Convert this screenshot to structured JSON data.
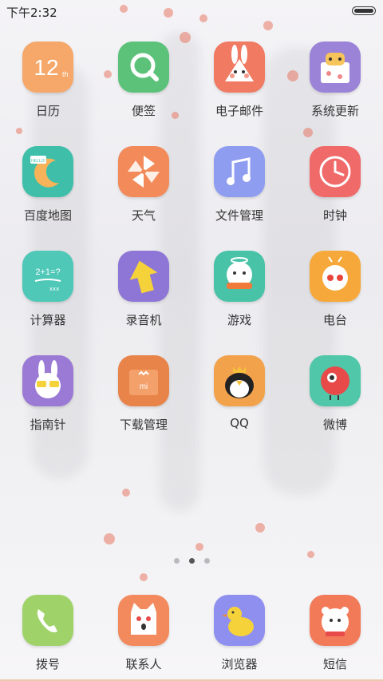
{
  "status_bar": {
    "time": "下午2:32",
    "battery_icon": "battery-icon"
  },
  "apps": [
    {
      "label": "日历",
      "icon": "calendar-icon",
      "color": "#f5a86a",
      "glyph": "12",
      "sub": "th"
    },
    {
      "label": "便签",
      "icon": "notes-icon",
      "color": "#5cc27a"
    },
    {
      "label": "电子邮件",
      "icon": "rabbit-mail-icon",
      "color": "#f07a62"
    },
    {
      "label": "系统更新",
      "icon": "box-update-icon",
      "color": "#9b84d8"
    },
    {
      "label": "百度地图",
      "icon": "moon-map-icon",
      "color": "#3fbfa9",
      "glyph": "HELLO!"
    },
    {
      "label": "天气",
      "icon": "pinwheel-icon",
      "color": "#f28a5a"
    },
    {
      "label": "文件管理",
      "icon": "music-note-icon",
      "color": "#8f9df0"
    },
    {
      "label": "时钟",
      "icon": "clock-icon",
      "color": "#f06a6a"
    },
    {
      "label": "计算器",
      "icon": "chalkboard-icon",
      "color": "#4fc8b8",
      "glyph": "2+1=?"
    },
    {
      "label": "录音机",
      "icon": "arrow-up-icon",
      "color": "#8d76d6"
    },
    {
      "label": "游戏",
      "icon": "bear-scarf-icon",
      "color": "#49c3a8"
    },
    {
      "label": "电台",
      "icon": "radio-bear-icon",
      "color": "#f6a93a"
    },
    {
      "label": "指南针",
      "icon": "bunny-glasses-icon",
      "color": "#9a7ad4"
    },
    {
      "label": "下载管理",
      "icon": "download-box-icon",
      "color": "#e8844a",
      "glyph": "mi"
    },
    {
      "label": "QQ",
      "icon": "penguin-icon",
      "color": "#f3a24c"
    },
    {
      "label": "微博",
      "icon": "red-bird-icon",
      "color": "#4fc7a8"
    }
  ],
  "page_indicator": {
    "count": 3,
    "active": 1
  },
  "dock": [
    {
      "label": "拨号",
      "icon": "phone-icon",
      "color": "#9fd36a"
    },
    {
      "label": "联系人",
      "icon": "cat-contacts-icon",
      "color": "#f38a5e"
    },
    {
      "label": "浏览器",
      "icon": "duck-icon",
      "color": "#8f8ff0"
    },
    {
      "label": "短信",
      "icon": "bear-sms-icon",
      "color": "#f27a58"
    }
  ]
}
